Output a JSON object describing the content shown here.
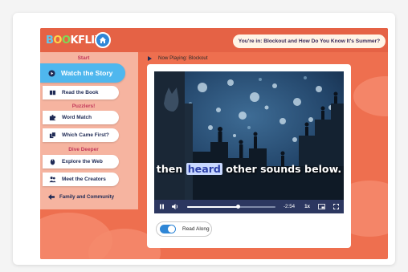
{
  "header": {
    "logo": "BOOKFLIX",
    "location": "You're in: Blockout and How Do You Know It's Summer?"
  },
  "sidebar": {
    "section_start": "Start",
    "watch_story": "Watch the Story",
    "read_book": "Read the Book",
    "section_puzzlers": "Puzzlers!",
    "word_match": "Word Match",
    "which_first": "Which Came First?",
    "section_deeper": "Dive Deeper",
    "explore_web": "Explore the Web",
    "meet_creators": "Meet the Creators",
    "family": "Family and Community"
  },
  "player": {
    "now_playing": "Now Playing: Blockout",
    "caption_word": "heard",
    "caption_before": "then ",
    "caption_after": " other sounds below.",
    "time_remaining": "-2:54",
    "speed": "1x",
    "progress": 0.58,
    "read_along_label": "Read Along",
    "read_along_on": true
  },
  "colors": {
    "app_bg": "#ee6f4f",
    "active_item": "#4fb7ee",
    "section_heading": "#c2385a",
    "controls_bar": "#2c3760"
  }
}
